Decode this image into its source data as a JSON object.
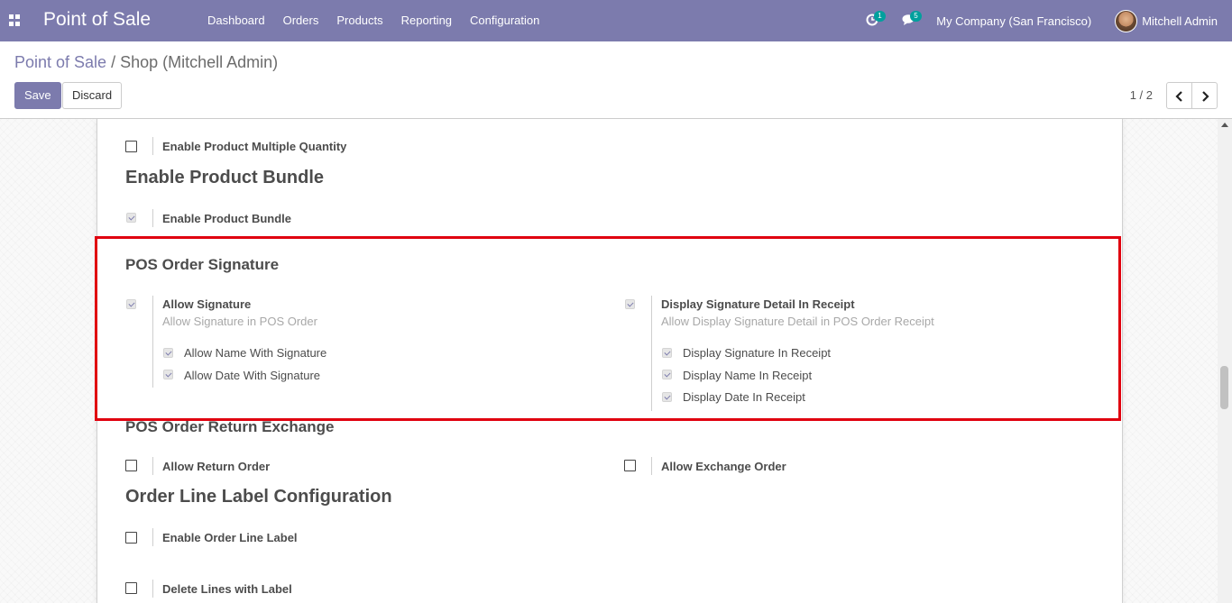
{
  "navbar": {
    "app_title": "Point of Sale",
    "menu": [
      "Dashboard",
      "Orders",
      "Products",
      "Reporting",
      "Configuration"
    ],
    "activity_count": "1",
    "messages_count": "5",
    "company": "My Company (San Francisco)",
    "user": "Mitchell Admin"
  },
  "breadcrumb": {
    "parent": "Point of Sale",
    "separator": "/",
    "current": "Shop (Mitchell Admin)"
  },
  "buttons": {
    "save": "Save",
    "discard": "Discard"
  },
  "pager": {
    "value": "1 / 2"
  },
  "form": {
    "multi_qty": {
      "label": "Enable Product Multiple Quantity",
      "checked": false
    },
    "bundle_heading": "Enable Product Bundle",
    "bundle": {
      "label": "Enable Product Bundle",
      "checked": true
    },
    "signature_heading": "POS Order Signature",
    "allow_signature": {
      "label": "Allow Signature",
      "hint": "Allow Signature in POS Order",
      "checked": true
    },
    "allow_name_sig": {
      "label": "Allow Name With Signature",
      "checked": true
    },
    "allow_date_sig": {
      "label": "Allow Date With Signature",
      "checked": true
    },
    "display_sig_detail": {
      "label": "Display Signature Detail In Receipt",
      "hint": "Allow Display Signature Detail in POS Order Receipt",
      "checked": true
    },
    "display_sig": {
      "label": "Display Signature In Receipt",
      "checked": true
    },
    "display_name": {
      "label": "Display Name In Receipt",
      "checked": true
    },
    "display_date": {
      "label": "Display Date In Receipt",
      "checked": true
    },
    "return_heading": "POS Order Return Exchange",
    "allow_return": {
      "label": "Allow Return Order",
      "checked": false
    },
    "allow_exchange": {
      "label": "Allow Exchange Order",
      "checked": false
    },
    "line_label_heading": "Order Line Label Configuration",
    "enable_line_label": {
      "label": "Enable Order Line Label",
      "checked": false
    },
    "delete_lines": {
      "label": "Delete Lines with Label",
      "checked": false
    }
  },
  "colors": {
    "navbar": "#7c7bad",
    "highlight": "#e0000f",
    "badge": "#00a09d"
  }
}
